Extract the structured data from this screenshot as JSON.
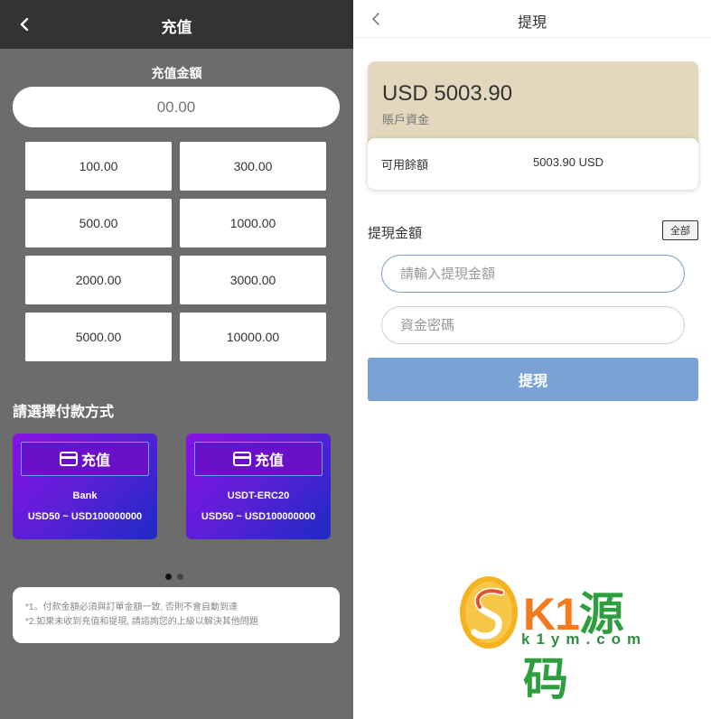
{
  "left": {
    "title": "充值",
    "amount_label": "充值金額",
    "amount_placeholder": "00.00",
    "presets": [
      "100.00",
      "300.00",
      "500.00",
      "1000.00",
      "2000.00",
      "3000.00",
      "5000.00",
      "10000.00"
    ],
    "payment_heading": "請選擇付款方式",
    "payment_methods": [
      {
        "button_label": "充值",
        "name": "Bank",
        "range": "USD50 ~ USD100000000"
      },
      {
        "button_label": "充值",
        "name": "USDT-ERC20",
        "range": "USD50 ~ USD100000000"
      }
    ],
    "notices": [
      "*1。付款金額必須與訂單金額一致, 否則不會自動到達",
      "*2.如果未收到充值和提現, 請諮詢您的上級以解決其他問題"
    ]
  },
  "right": {
    "title": "提現",
    "balance": "USD 5003.90",
    "balance_label": "賬戶資金",
    "available_label": "可用餘額",
    "available_value": "5003.90 USD",
    "withdraw_label": "提現金額",
    "all_button": "全部",
    "amount_placeholder": "請輸入提現金額",
    "password_placeholder": "資金密碼",
    "submit_label": "提現"
  },
  "watermark": {
    "brand_k1": "K1",
    "brand_zh": "源码",
    "domain": "k1ym.com"
  },
  "colors": {
    "left_bg": "#6c6c6c",
    "left_header": "#333333",
    "card_gradient_start": "#8a10e6",
    "card_gradient_end": "#1c2bc4",
    "balance_card": "#e3d8bd",
    "submit_button": "#7aa3d4"
  }
}
